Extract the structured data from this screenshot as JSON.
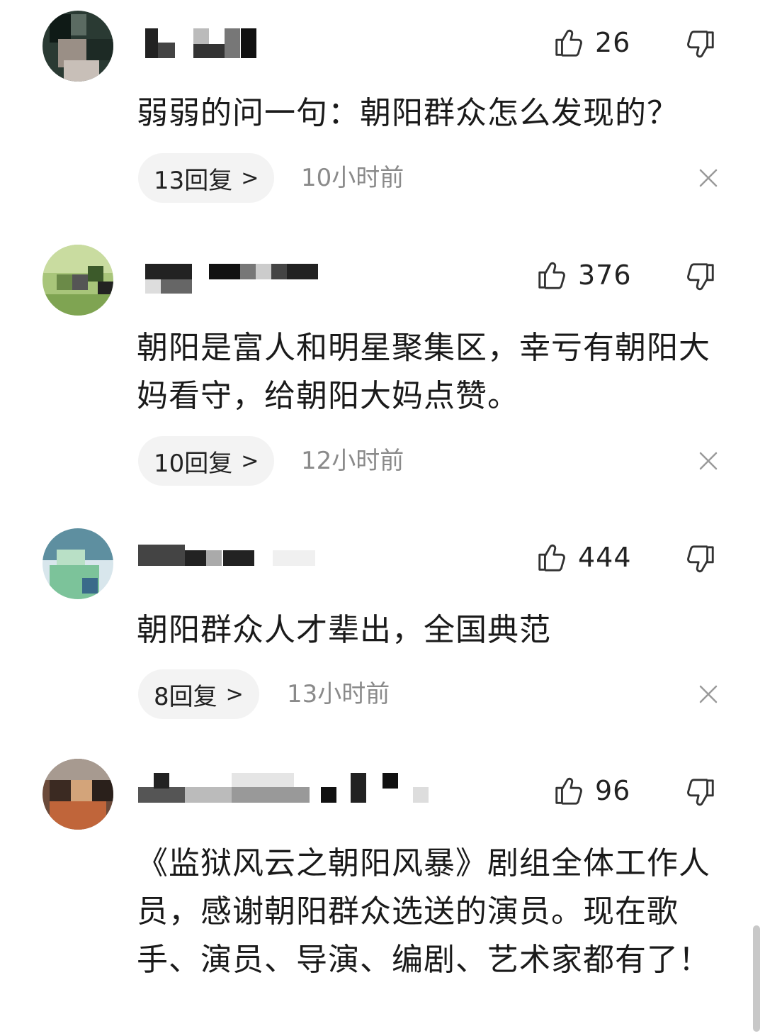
{
  "comments": [
    {
      "likes": "26",
      "text": "弱弱的问一句：朝阳群众怎么发现的？",
      "replies": "13回复",
      "time": "10小时前"
    },
    {
      "likes": "376",
      "text": "朝阳是富人和明星聚集区，幸亏有朝阳大妈看守，给朝阳大妈点赞。",
      "replies": "10回复",
      "time": "12小时前"
    },
    {
      "likes": "444",
      "text": "朝阳群众人才辈出，全国典范",
      "replies": "8回复",
      "time": "13小时前"
    },
    {
      "likes": "96",
      "text": "《监狱风云之朝阳风暴》剧组全体工作人员，感谢朝阳群众选送的演员。现在歌手、演员、导演、编剧、艺术家都有了！"
    }
  ],
  "colors": {
    "text": "#1a1a1a",
    "muted": "#8a8a8a",
    "pill": "#f3f3f3",
    "icon": "#333333"
  },
  "icons": {
    "like": "thumbs-up-icon",
    "dislike": "thumbs-down-icon",
    "close": "close-icon",
    "chevron": "chevron-right-icon"
  }
}
